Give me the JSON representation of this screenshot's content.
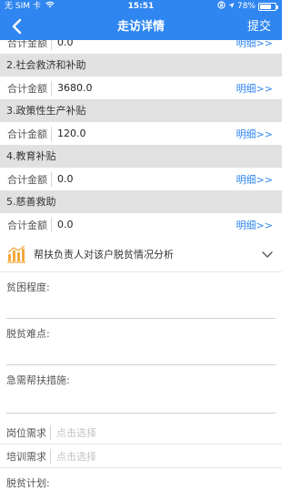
{
  "status": {
    "carrier": "无 SIM 卡",
    "time": "15:51",
    "battery": "78%",
    "battery_level": 0.78
  },
  "nav": {
    "title": "走访详情",
    "submit_label": "提交"
  },
  "amounts": {
    "label": "合计金额",
    "detail_label": "明细>>",
    "partial_value": "0.0"
  },
  "groups": [
    {
      "title": "2.社会救济和补助",
      "value": "3680.0"
    },
    {
      "title": "3.政策性生产补贴",
      "value": "120.0"
    },
    {
      "title": "4.教育补贴",
      "value": "0.0"
    },
    {
      "title": "5.慈善救助",
      "value": "0.0"
    }
  ],
  "analysis": {
    "title": "帮扶负责人对该户脱贫情况分析",
    "fields": [
      {
        "label": "贫困程度:"
      },
      {
        "label": "脱贫难点:"
      },
      {
        "label": "急需帮扶措施:"
      }
    ],
    "selects": [
      {
        "label": "岗位需求",
        "placeholder": "点击选择"
      },
      {
        "label": "培训需求",
        "placeholder": "点击选择"
      }
    ],
    "plan_label": "脱贫计划:"
  }
}
